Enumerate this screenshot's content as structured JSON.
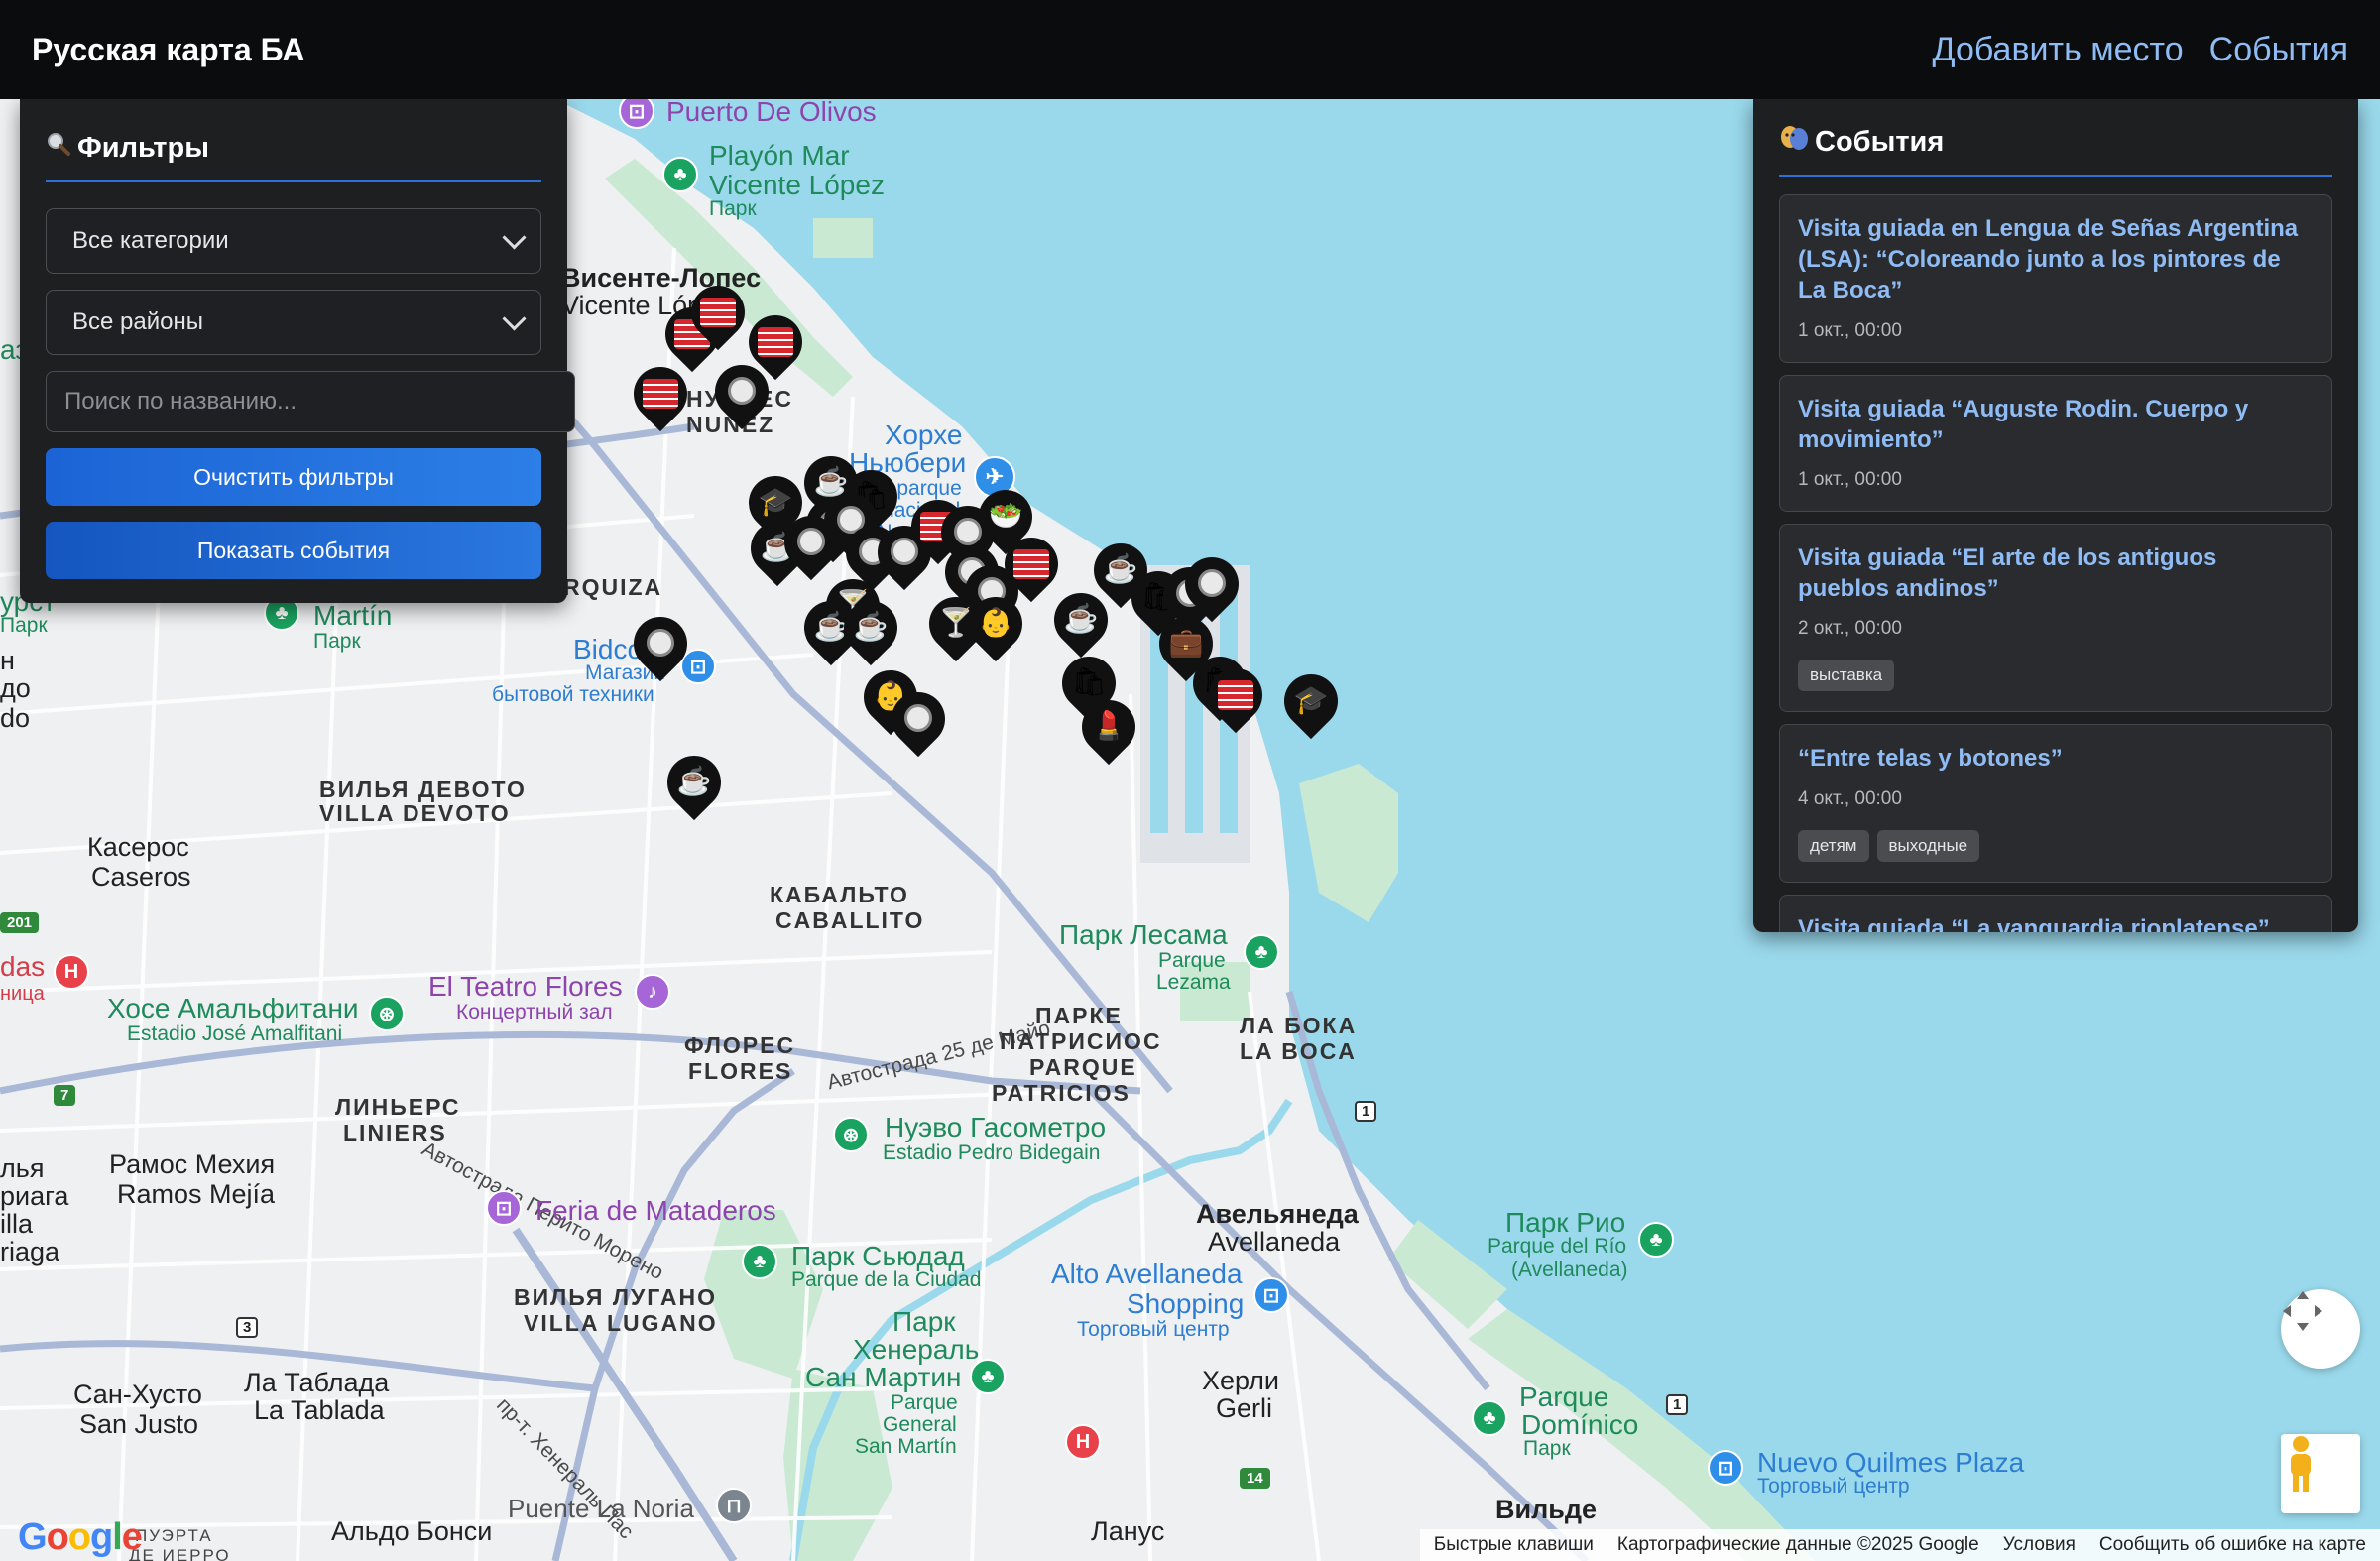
{
  "header": {
    "title": "Русская карта БА",
    "nav": [
      "Добавить место",
      "События"
    ]
  },
  "filters": {
    "icon": "magnifier-icon",
    "title": "Фильтры",
    "category_select": "Все категории",
    "district_select": "Все районы",
    "search_placeholder": "Поиск по названию...",
    "clear_button": "Очистить фильтры",
    "show_events_button": "Показать события"
  },
  "events_panel": {
    "icon": "masks-icon",
    "title": "События",
    "items": [
      {
        "title": "Visita guiada en Lengua de Señas Argentina (LSA): “Coloreando junto a los pintores de La Boca”",
        "date": "1 окт., 00:00",
        "tags": []
      },
      {
        "title": "Visita guiada “Auguste Rodin. Cuerpo y movimiento”",
        "date": "1 окт., 00:00",
        "tags": []
      },
      {
        "title": "Visita guiada “El arte de los antiguos pueblos andinos”",
        "date": "2 окт., 00:00",
        "tags": [
          "выставка"
        ]
      },
      {
        "title": "“Entre telas y botones”",
        "date": "4 окт., 00:00",
        "tags": [
          "детям",
          "выходные"
        ]
      },
      {
        "title": "Visita guiada “La vanguardia rioplatense”",
        "date": "",
        "tags": []
      }
    ]
  },
  "map": {
    "colors": {
      "water": "#9ad9ec",
      "land": "#eef0f2",
      "park": "#c9e9d3",
      "road": "#ffffff",
      "highway": "#a9b8d6"
    },
    "labels": {
      "puerto_olivos": "Puerto De Olivos",
      "playon_1": "Playón Mar",
      "playon_2": "Vicente López",
      "playon_3": "Парк",
      "vl_ru": "Висенте-Лопес",
      "vl_es": "Vicente López",
      "nunez": "НУНЬЕС",
      "nunez2": "NUÑEZ",
      "aero_ru": "Хорхе",
      "aero_ru2": "Ньюбери",
      "aero_es1": "Aeroparque",
      "aero_es2": "Internacional",
      "aero_es3": "Jorge Newbery",
      "urquiza": "RQUIZA",
      "martin": "Martín",
      "martin_p": "Парк",
      "bidcom": "Bidcom",
      "bidcom2": "Магазин",
      "bidcom3": "бытовой техники",
      "devoto_ru": "ВИЛЬЯ ДЕВОТО",
      "devoto_es": "VILLA DEVOTO",
      "caseros_ru": "Касерос",
      "caseros_es": "Caseros",
      "caballito_ru": "КАБАЛЬТО",
      "caballito_es": "CABALLITO",
      "lezama": "Парк Лесама",
      "lezama2": "Parque",
      "lezama3": "Lezama",
      "teatro": "El Teatro Flores",
      "teatro2": "Концертный зал",
      "amalfitani": "Хосе Амальфитани",
      "amalfitani2": "Estadio José Amalfitani",
      "autopista25": "Автострада 25 де Майо",
      "autoperito": "Автострада Перито Морено",
      "flores_ru": "ФЛОРЕС",
      "flores_es": "FLORES",
      "patricios_ru": "ПАРКЕ",
      "patricios_ru2": "ПАТРИСИОС",
      "patricios_es": "PARQUE",
      "patricios_es2": "PATRICIOS",
      "boca_ru": "ЛА БОКА",
      "boca_es": "LA BOCA",
      "liniers_ru": "ЛИНЬЕРС",
      "liniers_es": "LINIERS",
      "gasometro": "Нуэво Гасометро",
      "gasometro2": "Estadio Pedro Bidegain",
      "ramos_ru": "Рамос Мехия",
      "ramos_es": "Ramos Mejía",
      "mataderos": "Feria de Mataderos",
      "avellaneda_ru": "Авельянеда",
      "avellaneda_es": "Avellaneda",
      "rio_ru": "Парк Рио",
      "rio_es1": "Parque del Río",
      "rio_es2": "(Avellaneda)",
      "sudad": "Парк Сьюдад",
      "sudad2": "Parque de la Ciudad",
      "alto1": "Alto Avellaneda",
      "alto2": "Shopping",
      "alto3": "Торговый центр",
      "lugano_ru": "ВИЛЬЯ ЛУГАНО",
      "lugano_es": "VILLA LUGANO",
      "sanmartin1": "Парк",
      "sanmartin2": "Хенераль",
      "sanmartin3": "Сан Мартин",
      "sanmartin4": "Parque",
      "sanmartin5": "General",
      "sanmartin6": "San Martín",
      "herli_ru": "Херли",
      "herli_es": "Gerli",
      "dominico1": "Parque",
      "dominico2": "Domínico",
      "dominico3": "Парк",
      "quilmes1": "Nuevo Quilmes Plaza",
      "quilmes2": "Торговый центр",
      "sanjusto_ru": "Сан-Хусто",
      "sanjusto_es": "San Justo",
      "tablada_ru": "Ла Таблада",
      "tablada_es": "La Tablada",
      "noria": "Puente La Noria",
      "bonsi": "Альдо Бонси",
      "lanus": "Ланус",
      "wilde": "Вильде",
      "gral": "пр-т. Хенераль Пас",
      "pueyrredon": "ПУЭРТА",
      "hierro": "ДЕ ИЕРРО",
      "left1": "аз",
      "left2": "урст",
      "left3": "Парк",
      "left4": "н",
      "left5": "до",
      "left6": "do",
      "left7": "das",
      "left8": "ница",
      "left9": "лья",
      "left10": "риага",
      "left11": "illa",
      "left12": "riaga",
      "shield201": "201",
      "shield7": "7",
      "shield3": "3",
      "shield1": "1",
      "shield14": "14",
      "shieldb1": "1"
    }
  },
  "markers": [
    {
      "type": "ticket",
      "icon": "ticket-icon"
    },
    {
      "type": "plate",
      "icon": "plate-icon"
    },
    {
      "type": "coffee",
      "icon": "coffee-icon"
    },
    {
      "type": "shopping",
      "icon": "shopping-bags-icon"
    },
    {
      "type": "education",
      "icon": "graduation-cap-icon"
    },
    {
      "type": "kids",
      "icon": "baby-icon"
    },
    {
      "type": "bar",
      "icon": "cocktail-icon"
    },
    {
      "type": "beauty",
      "icon": "lipstick-icon"
    },
    {
      "type": "salad",
      "icon": "salad-icon"
    },
    {
      "type": "work",
      "icon": "briefcase-icon"
    }
  ],
  "controls": {
    "pan": "pan-control",
    "pegman": "street-view-pegman-icon"
  },
  "footer": {
    "shortcuts": "Быстрые клавиши",
    "data": "Картографические данные ©2025 Google",
    "terms": "Условия",
    "report": "Сообщить об ошибке на карте",
    "logo": "Google"
  }
}
